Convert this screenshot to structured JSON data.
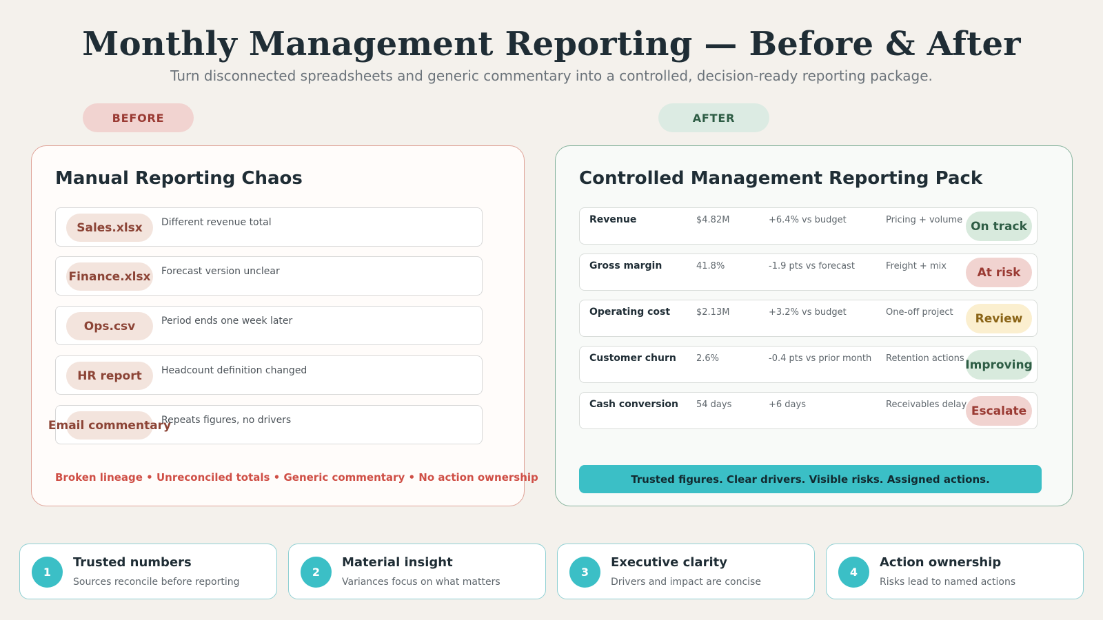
{
  "header": {
    "title": "Monthly Management Reporting — Before & After",
    "subtitle": "Turn disconnected spreadsheets and generic commentary into a controlled, decision-ready reporting package."
  },
  "before": {
    "label": "BEFORE",
    "title": "Manual Reporting Chaos",
    "rows": [
      {
        "file": "Sales.xlsx",
        "desc": "Different revenue total"
      },
      {
        "file": "Finance.xlsx",
        "desc": "Forecast version unclear"
      },
      {
        "file": "Ops.csv",
        "desc": "Period ends one week later"
      },
      {
        "file": "HR report",
        "desc": "Headcount definition changed"
      },
      {
        "file": "Email commentary",
        "desc": "Repeats figures, no drivers"
      }
    ],
    "footer": "Broken lineage • Unreconciled totals • Generic commentary • No action ownership"
  },
  "after": {
    "label": "AFTER",
    "title": "Controlled Management Reporting Pack",
    "rows": [
      {
        "metric": "Revenue",
        "value": "$4.82M",
        "variance": "+6.4% vs budget",
        "driver": "Pricing + volume",
        "status": "On track"
      },
      {
        "metric": "Gross margin",
        "value": "41.8%",
        "variance": "-1.9 pts vs forecast",
        "driver": "Freight + mix",
        "status": "At risk"
      },
      {
        "metric": "Operating cost",
        "value": "$2.13M",
        "variance": "+3.2% vs budget",
        "driver": "One-off project",
        "status": "Review"
      },
      {
        "metric": "Customer churn",
        "value": "2.6%",
        "variance": "-0.4 pts vs prior month",
        "driver": "Retention actions",
        "status": "Improving"
      },
      {
        "metric": "Cash conversion",
        "value": "54 days",
        "variance": "+6 days",
        "driver": "Receivables delay",
        "status": "Escalate"
      }
    ],
    "banner": "Trusted figures. Clear drivers. Visible risks. Assigned actions."
  },
  "cards": [
    {
      "num": "1",
      "title": "Trusted numbers",
      "sub": "Sources reconcile before reporting"
    },
    {
      "num": "2",
      "title": "Material insight",
      "sub": "Variances focus on what matters"
    },
    {
      "num": "3",
      "title": "Executive clarity",
      "sub": "Drivers and impact are concise"
    },
    {
      "num": "4",
      "title": "Action ownership",
      "sub": "Risks lead to named actions"
    }
  ],
  "colors": {
    "teal": "#3bbfc6",
    "before_accent": "#cf4f46",
    "after_accent": "#2e5d45"
  }
}
